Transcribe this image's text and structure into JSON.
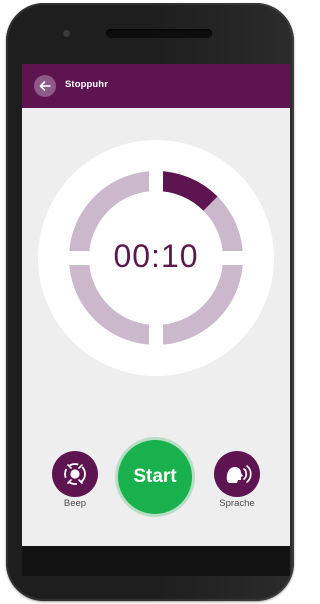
{
  "app_bar": {
    "title": "Stoppuhr",
    "back_icon": "arrow-left-icon"
  },
  "timer": {
    "display": "00:10",
    "progress_fraction": 0.125
  },
  "controls": {
    "beep": {
      "label": "Beep",
      "icon": "sound-target-icon"
    },
    "start": {
      "label": "Start"
    },
    "speech": {
      "label": "Sprache",
      "icon": "speaking-head-icon"
    }
  },
  "colors": {
    "brand_purple": "#5e1451",
    "ring_track": "#cbb8cc",
    "start_green": "#19b14d",
    "screen_bg": "#eeeeee"
  }
}
